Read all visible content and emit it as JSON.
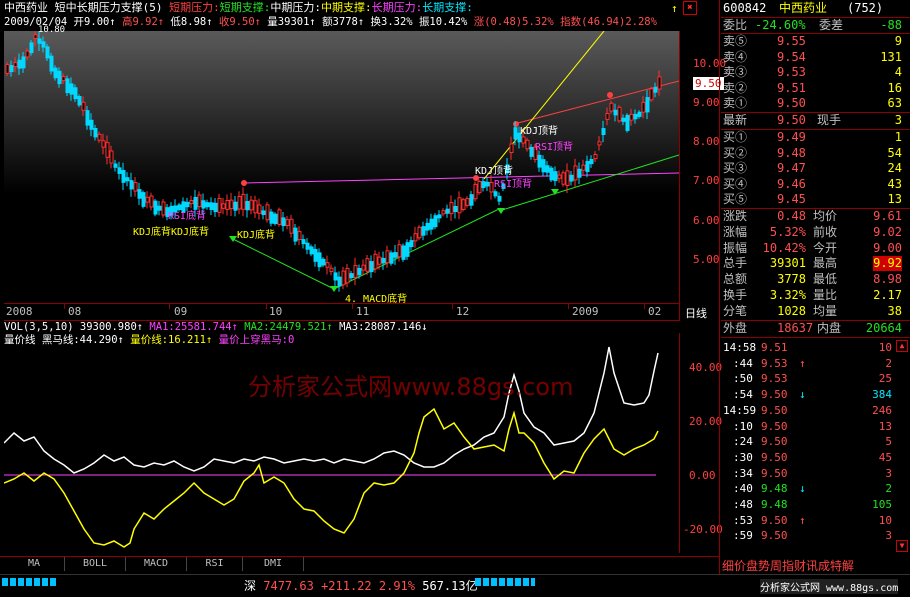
{
  "header": {
    "stock_name": "中西药业",
    "indicator_title": "短中长期压力支撑(5)",
    "legend": [
      {
        "label": "短期压力:",
        "color": "#ff4040"
      },
      {
        "label": "短期支撑:",
        "color": "#22e022"
      },
      {
        "label": "中期压力:",
        "color": "#ffffff"
      },
      {
        "label": "中期支撑:",
        "color": "#ffff00"
      },
      {
        "label": "长期压力:",
        "color": "#ff40ff"
      },
      {
        "label": "长期支撑:",
        "color": "#00e8ff"
      }
    ]
  },
  "quote_line": {
    "date": "2009/02/04",
    "open": "开9.00↑",
    "high": "高9.92↑",
    "low": "低8.98↑",
    "close": "收9.50↑",
    "volume": "量39301↑",
    "amount": "额3778↑",
    "turnover": "换3.32%",
    "amplitude": "振10.42%",
    "change": "涨(0.48)5.32%",
    "index": "指数(46.94)2.28%"
  },
  "price_axis": [
    "10.00",
    "9.00",
    "8.00",
    "7.00",
    "6.00",
    "5.00"
  ],
  "current_price_tag": "9.50",
  "chart_top_price": "10.80",
  "annotations": {
    "rsi_bottom_1": "RSI底背",
    "kdj_bottom_1": "KDJ底背",
    "kdj_bottom_2": "KDJ底背",
    "kdj_bottom_3": "KDJ底背",
    "macd_bottom": "4.   MACD底背",
    "kdj_top_1": "KDJ顶背",
    "rsi_top_1": "RSI顶背",
    "kdj_top_2": "KDJ顶背",
    "rsi_top_2": "RSI顶背"
  },
  "time_axis": [
    "2008",
    "08",
    "09",
    "10",
    "11",
    "12",
    "2009",
    "02"
  ],
  "period_label": "日线",
  "vol_line": {
    "title": "VOL(3,5,10)",
    "value": "39300.980↑",
    "ma1": "MA1:25581.744↑",
    "ma2": "MA2:24479.521↑",
    "ma3": "MA3:28087.146↓"
  },
  "indicator_line": {
    "name": "量价线",
    "horse": "黑马线:44.290↑",
    "qp": "量价线:16.211↑",
    "cross": "量价上穿黑马:0"
  },
  "indicator_axis": [
    "40.00",
    "20.00",
    "0.00",
    "-20.00"
  ],
  "watermark": "分析家公式网www.88gs.com",
  "tabs": [
    "MA",
    "BOLL",
    "MACD",
    "RSI",
    "DMI"
  ],
  "bottom_bar": {
    "market": "深",
    "index": "7477.63",
    "change": "+211.22",
    "pct": "2.91%",
    "amount": "567.13亿"
  },
  "right_panel": {
    "code": "600842",
    "name": "中西药业",
    "num": "(752)",
    "weibi_label": "委比",
    "weibi": "-24.60%",
    "weicha_label": "委差",
    "weicha": "-88",
    "sells": [
      {
        "label": "卖⑤",
        "price": "9.55",
        "vol": "9"
      },
      {
        "label": "卖④",
        "price": "9.54",
        "vol": "131"
      },
      {
        "label": "卖③",
        "price": "9.53",
        "vol": "4"
      },
      {
        "label": "卖②",
        "price": "9.51",
        "vol": "16"
      },
      {
        "label": "卖①",
        "price": "9.50",
        "vol": "63"
      }
    ],
    "last": {
      "label": "最新",
      "price": "9.50",
      "label2": "现手",
      "vol": "3"
    },
    "buys": [
      {
        "label": "买①",
        "price": "9.49",
        "vol": "1"
      },
      {
        "label": "买②",
        "price": "9.48",
        "vol": "54"
      },
      {
        "label": "买③",
        "price": "9.47",
        "vol": "24"
      },
      {
        "label": "买④",
        "price": "9.46",
        "vol": "43"
      },
      {
        "label": "买⑤",
        "price": "9.45",
        "vol": "13"
      }
    ],
    "stats": [
      {
        "l1": "涨跌",
        "v1": "0.48",
        "l2": "均价",
        "v2": "9.61"
      },
      {
        "l1": "涨幅",
        "v1": "5.32%",
        "l2": "前收",
        "v2": "9.02"
      },
      {
        "l1": "振幅",
        "v1": "10.42%",
        "l2": "今开",
        "v2": "9.00"
      },
      {
        "l1": "总手",
        "v1": "39301",
        "l2": "最高",
        "v2": "9.92"
      },
      {
        "l1": "总额",
        "v1": "3778",
        "l2": "最低",
        "v2": "8.98"
      },
      {
        "l1": "换手",
        "v1": "3.32%",
        "l2": "量比",
        "v2": "2.17"
      },
      {
        "l1": "分笔",
        "v1": "1028",
        "l2": "均量",
        "v2": "38"
      }
    ],
    "outer_label": "外盘",
    "outer": "18637",
    "inner_label": "内盘",
    "inner": "20664",
    "ticks": [
      {
        "t": "14:58",
        "p": "9.51",
        "a": "",
        "v": "10"
      },
      {
        "t": ":44",
        "p": "9.53",
        "a": "↑",
        "v": "2"
      },
      {
        "t": ":50",
        "p": "9.53",
        "a": "",
        "v": "25"
      },
      {
        "t": ":54",
        "p": "9.50",
        "a": "↓",
        "v": "384"
      },
      {
        "t": "14:59",
        "p": "9.50",
        "a": "",
        "v": "246"
      },
      {
        "t": ":10",
        "p": "9.50",
        "a": "",
        "v": "13"
      },
      {
        "t": ":24",
        "p": "9.50",
        "a": "",
        "v": "5"
      },
      {
        "t": ":30",
        "p": "9.50",
        "a": "",
        "v": "45"
      },
      {
        "t": ":34",
        "p": "9.50",
        "a": "",
        "v": "3"
      },
      {
        "t": ":40",
        "p": "9.48",
        "a": "↓",
        "v": "2"
      },
      {
        "t": ":48",
        "p": "9.48",
        "a": "",
        "v": "105"
      },
      {
        "t": ":53",
        "p": "9.50",
        "a": "↑",
        "v": "10"
      },
      {
        "t": ":59",
        "p": "9.50",
        "a": "",
        "v": "3"
      }
    ],
    "footer_tabs": "细价盘势周指财讯成特解",
    "footer_site": "分析家公式网 www.88gs.com"
  }
}
